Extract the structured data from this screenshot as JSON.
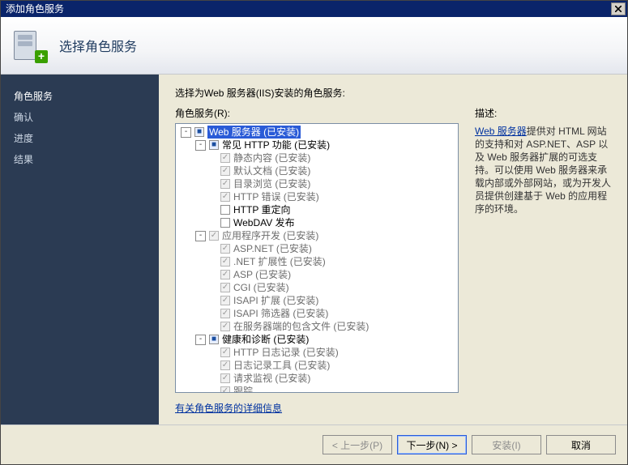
{
  "window_title": "添加角色服务",
  "heading": "选择角色服务",
  "sidebar": {
    "steps": [
      {
        "label": "角色服务",
        "current": true
      },
      {
        "label": "确认",
        "current": false
      },
      {
        "label": "进度",
        "current": false
      },
      {
        "label": "结果",
        "current": false
      }
    ]
  },
  "content": {
    "instruction": "选择为Web 服务器(IIS)安装的角色服务:",
    "roles_label": "角色服务(R):",
    "learn_more": "有关角色服务的详细信息"
  },
  "description": {
    "heading": "描述:",
    "link_text": "Web 服务器",
    "body": "提供对 HTML 网站的支持和对 ASP.NET、ASP 以及 Web 服务器扩展的可选支持。可以使用 Web 服务器来承载内部或外部网站，或为开发人员提供创建基于 Web 的应用程序的环境。"
  },
  "tree": [
    {
      "depth": 0,
      "expander": "-",
      "check": "tri",
      "label": "Web 服务器  (已安装)",
      "selected": true
    },
    {
      "depth": 1,
      "expander": "-",
      "check": "tri",
      "label": "常见 HTTP 功能  (已安装)"
    },
    {
      "depth": 2,
      "expander": "",
      "check": "on-dis",
      "label": "静态内容  (已安装)",
      "disabled": true
    },
    {
      "depth": 2,
      "expander": "",
      "check": "on-dis",
      "label": "默认文档  (已安装)",
      "disabled": true
    },
    {
      "depth": 2,
      "expander": "",
      "check": "on-dis",
      "label": "目录浏览  (已安装)",
      "disabled": true
    },
    {
      "depth": 2,
      "expander": "",
      "check": "on-dis",
      "label": "HTTP 错误  (已安装)",
      "disabled": true
    },
    {
      "depth": 2,
      "expander": "",
      "check": "off",
      "label": "HTTP 重定向"
    },
    {
      "depth": 2,
      "expander": "",
      "check": "off",
      "label": "WebDAV 发布"
    },
    {
      "depth": 1,
      "expander": "-",
      "check": "on-dis",
      "label": "应用程序开发  (已安装)",
      "disabled": true
    },
    {
      "depth": 2,
      "expander": "",
      "check": "on-dis",
      "label": "ASP.NET  (已安装)",
      "disabled": true
    },
    {
      "depth": 2,
      "expander": "",
      "check": "on-dis",
      "label": ".NET 扩展性  (已安装)",
      "disabled": true
    },
    {
      "depth": 2,
      "expander": "",
      "check": "on-dis",
      "label": "ASP  (已安装)",
      "disabled": true
    },
    {
      "depth": 2,
      "expander": "",
      "check": "on-dis",
      "label": "CGI  (已安装)",
      "disabled": true
    },
    {
      "depth": 2,
      "expander": "",
      "check": "on-dis",
      "label": "ISAPI 扩展  (已安装)",
      "disabled": true
    },
    {
      "depth": 2,
      "expander": "",
      "check": "on-dis",
      "label": "ISAPI 筛选器  (已安装)",
      "disabled": true
    },
    {
      "depth": 2,
      "expander": "",
      "check": "on-dis",
      "label": "在服务器端的包含文件  (已安装)",
      "disabled": true
    },
    {
      "depth": 1,
      "expander": "-",
      "check": "tri",
      "label": "健康和诊断  (已安装)"
    },
    {
      "depth": 2,
      "expander": "",
      "check": "on-dis",
      "label": "HTTP 日志记录  (已安装)",
      "disabled": true
    },
    {
      "depth": 2,
      "expander": "",
      "check": "on-dis",
      "label": "日志记录工具  (已安装)",
      "disabled": true
    },
    {
      "depth": 2,
      "expander": "",
      "check": "on-dis",
      "label": "请求监视  (已安装)",
      "disabled": true
    },
    {
      "depth": 2,
      "expander": "",
      "check": "on-dis",
      "label": "跟踪",
      "disabled": true
    }
  ],
  "footer": {
    "prev": "< 上一步(P)",
    "next": "下一步(N) >",
    "install": "安装(I)",
    "cancel": "取消"
  }
}
